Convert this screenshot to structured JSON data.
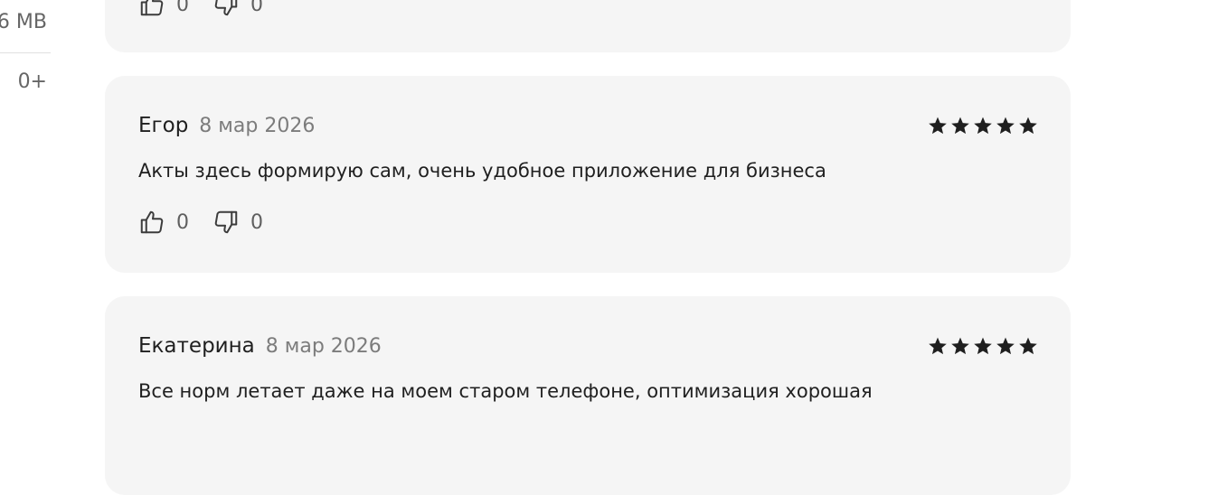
{
  "sidebar": {
    "size": "6 MB",
    "age_rating": "0+"
  },
  "reviews": [
    {
      "likes": "0",
      "dislikes": "0"
    },
    {
      "author": "Егор",
      "date": "8 мар 2026",
      "rating": 5,
      "text": "Акты здесь формирую сам, очень удобное приложение для бизнеса",
      "likes": "0",
      "dislikes": "0"
    },
    {
      "author": "Екатерина",
      "date": "8 мар 2026",
      "rating": 5,
      "text": "Все норм летает даже на моем старом телефоне, оптимизация хорошая"
    }
  ],
  "icons": {
    "star": "star-icon",
    "like": "thumb-up-icon",
    "dislike": "thumb-down-icon"
  },
  "colors": {
    "card_background": "#f5f5f5",
    "star": "#1f1f1f",
    "date_text": "#7c7c7c"
  }
}
